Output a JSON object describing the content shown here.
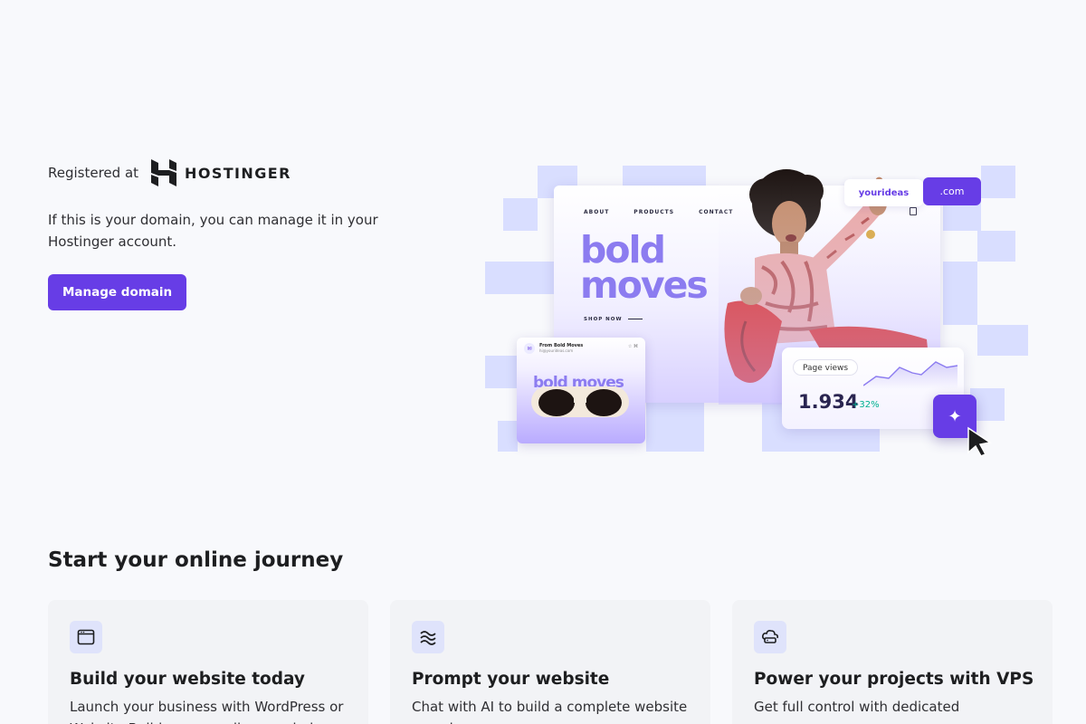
{
  "hero": {
    "registered_label": "Registered at",
    "brand_name": "HOSTINGER",
    "description": "If this is your domain, you can manage it in your Hostinger account.",
    "manage_button": "Manage domain"
  },
  "illustration": {
    "nav": [
      "ABOUT",
      "PRODUCTS",
      "CONTACT"
    ],
    "headline_line1": "bold",
    "headline_line2": "moves",
    "shop_now": "SHOP NOW",
    "domain_name": "yourideas",
    "domain_tld": ".com",
    "email": {
      "from": "From Bold Moves",
      "address": "hi@yourideas.com",
      "headline": "bold moves"
    },
    "stats": {
      "label": "Page views",
      "value": "1.934",
      "change": "+32%"
    }
  },
  "journey": {
    "title": "Start your online journey",
    "cards": [
      {
        "icon": "browser-window-icon",
        "title": "Build your website today",
        "text": "Launch your business with WordPress or Website Builder – no coding needed."
      },
      {
        "icon": "ai-waves-icon",
        "title": "Prompt your website",
        "text": "Chat with AI to build a complete website or web app."
      },
      {
        "icon": "cloud-server-icon",
        "title": "Power your projects with VPS",
        "text": "Get full control with dedicated resources."
      }
    ]
  },
  "colors": {
    "accent": "#673de6",
    "background": "#f8f9fc",
    "card_bg": "#f2f3f6",
    "success": "#00b090"
  }
}
